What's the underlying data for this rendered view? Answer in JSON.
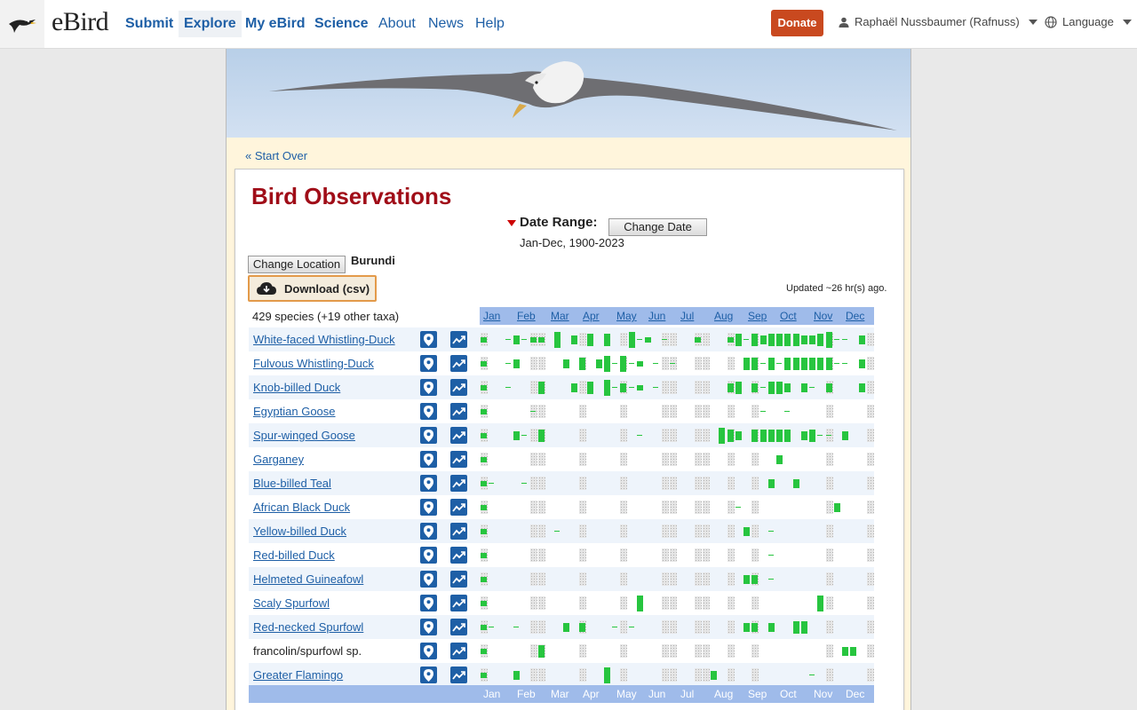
{
  "nav": {
    "logo_word": "eBird",
    "items": [
      {
        "label": "Submit",
        "bold": true
      },
      {
        "label": "Explore",
        "bold": true,
        "active": true
      },
      {
        "label": "My eBird",
        "bold": true
      },
      {
        "label": "Science",
        "bold": true
      },
      {
        "label": "About",
        "bold": false
      },
      {
        "label": "News",
        "bold": false
      },
      {
        "label": "Help",
        "bold": false
      }
    ],
    "donate": "Donate",
    "user": "Raphaël Nussbaumer (Rafnuss)",
    "language": "Language"
  },
  "page": {
    "start_over": "« Start Over",
    "title": "Bird Observations",
    "date_range_label": "Date Range:",
    "change_date": "Change Date",
    "date_range_value": "Jan-Dec, 1900-2023",
    "change_location": "Change Location",
    "location": "Burundi",
    "download": "Download (csv)",
    "updated": "Updated ~26 hr(s) ago.",
    "species_count": "429 species (+19 other taxa)"
  },
  "months": [
    "Jan",
    "Feb",
    "Mar",
    "Apr",
    "May",
    "Jun",
    "Jul",
    "Aug",
    "Sep",
    "Oct",
    "Nov",
    "Dec"
  ],
  "species": [
    {
      "name": "White-faced Whistling-Duck",
      "link": true
    },
    {
      "name": "Fulvous Whistling-Duck",
      "link": true
    },
    {
      "name": "Knob-billed Duck",
      "link": true
    },
    {
      "name": "Egyptian Goose",
      "link": true
    },
    {
      "name": "Spur-winged Goose",
      "link": true
    },
    {
      "name": "Garganey",
      "link": true
    },
    {
      "name": "Blue-billed Teal",
      "link": true
    },
    {
      "name": "African Black Duck",
      "link": true
    },
    {
      "name": "Yellow-billed Duck",
      "link": true
    },
    {
      "name": "Red-billed Duck",
      "link": true
    },
    {
      "name": "Helmeted Guineafowl",
      "link": true
    },
    {
      "name": "Scaly Spurfowl",
      "link": true
    },
    {
      "name": "Red-necked Spurfowl",
      "link": true
    },
    {
      "name": "francolin/spurfowl sp.",
      "link": false
    },
    {
      "name": "Greater Flamingo",
      "link": true
    }
  ],
  "frequency_levels": [
    "0000000000000000000000000000000000000000000000",
    "x0000x0x0x00000000xxxxxxxxxxxxxxxxxxxxxxx00xxx",
    "0x00000000000000x00x00x00x00x00x0x00x0x0x00x00"
  ],
  "bar_rows": [
    [
      "n",
      "n",
      "n",
      "n",
      "n",
      "n",
      "n",
      "n",
      "n",
      "n",
      "n",
      "n",
      "n",
      "n",
      "n",
      "n",
      "n",
      "n",
      "n",
      "n",
      "n",
      "n",
      "n",
      "n",
      "n",
      "n",
      "n",
      "n",
      "n",
      "n",
      "n",
      "n",
      "n",
      "n",
      "n",
      "n",
      "n",
      "n",
      "n",
      "n",
      "n",
      "n",
      "n",
      "n",
      "n",
      "n",
      "n",
      "n"
    ],
    [
      2,
      0,
      0,
      1,
      3,
      1,
      2,
      2,
      0,
      5,
      0,
      3,
      0,
      4,
      0,
      4,
      0,
      0,
      5,
      1,
      2,
      0,
      1,
      0,
      0,
      0,
      2,
      0,
      0,
      0,
      2,
      4,
      1,
      4,
      3,
      4,
      4,
      4,
      4,
      3,
      3,
      4,
      5,
      1,
      1,
      0,
      3,
      0
    ],
    [
      2,
      0,
      0,
      1,
      3,
      0,
      0,
      0,
      0,
      0,
      3,
      0,
      4,
      0,
      3,
      5,
      1,
      5,
      1,
      2,
      0,
      1,
      0,
      1,
      0,
      0,
      0,
      0,
      0,
      0,
      0,
      0,
      4,
      4,
      1,
      4,
      1,
      4,
      4,
      4,
      4,
      4,
      4,
      1,
      1,
      0,
      3,
      0
    ],
    [
      2,
      0,
      0,
      1,
      0,
      0,
      0,
      4,
      0,
      0,
      0,
      3,
      0,
      4,
      0,
      5,
      1,
      3,
      1,
      2,
      0,
      1,
      0,
      0,
      0,
      0,
      0,
      0,
      0,
      0,
      3,
      4,
      0,
      3,
      1,
      4,
      4,
      3,
      0,
      3,
      1,
      0,
      3,
      0,
      0,
      0,
      3,
      0
    ],
    [
      2,
      0,
      0,
      0,
      0,
      0,
      1,
      0,
      0,
      0,
      0,
      0,
      0,
      0,
      0,
      0,
      0,
      0,
      0,
      0,
      0,
      0,
      0,
      0,
      0,
      0,
      0,
      0,
      0,
      0,
      0,
      0,
      0,
      0,
      1,
      0,
      0,
      1,
      0,
      0,
      0,
      0,
      0,
      0,
      0,
      0,
      0,
      0
    ],
    [
      2,
      0,
      0,
      0,
      3,
      1,
      0,
      4,
      0,
      0,
      0,
      0,
      0,
      0,
      0,
      0,
      0,
      0,
      0,
      1,
      0,
      0,
      0,
      0,
      0,
      0,
      0,
      0,
      0,
      5,
      4,
      3,
      0,
      4,
      4,
      4,
      4,
      4,
      0,
      3,
      4,
      1,
      1,
      0,
      3,
      0,
      0,
      0
    ],
    [
      2,
      0,
      0,
      0,
      0,
      0,
      0,
      0,
      0,
      0,
      0,
      0,
      0,
      0,
      0,
      0,
      0,
      0,
      0,
      0,
      0,
      0,
      0,
      0,
      0,
      0,
      0,
      0,
      0,
      0,
      0,
      0,
      0,
      0,
      0,
      0,
      3,
      0,
      0,
      0,
      0,
      0,
      0,
      0,
      0,
      0,
      0,
      0
    ],
    [
      2,
      1,
      0,
      0,
      0,
      1,
      0,
      0,
      0,
      0,
      0,
      0,
      0,
      0,
      0,
      0,
      0,
      0,
      0,
      0,
      0,
      0,
      0,
      0,
      0,
      0,
      0,
      0,
      0,
      0,
      0,
      0,
      0,
      0,
      0,
      3,
      0,
      0,
      3,
      0,
      0,
      0,
      0,
      0,
      0,
      0,
      0,
      0
    ],
    [
      2,
      0,
      0,
      0,
      0,
      0,
      0,
      0,
      0,
      0,
      0,
      0,
      0,
      0,
      0,
      0,
      0,
      0,
      0,
      0,
      0,
      0,
      0,
      0,
      0,
      0,
      0,
      0,
      0,
      0,
      0,
      1,
      0,
      0,
      0,
      0,
      0,
      0,
      0,
      0,
      0,
      0,
      0,
      3,
      0,
      0,
      0,
      0
    ],
    [
      2,
      0,
      0,
      0,
      0,
      0,
      0,
      0,
      0,
      1,
      0,
      0,
      0,
      0,
      0,
      0,
      0,
      0,
      0,
      0,
      0,
      0,
      0,
      0,
      0,
      0,
      0,
      0,
      0,
      0,
      0,
      0,
      3,
      0,
      0,
      1,
      0,
      0,
      0,
      0,
      0,
      0,
      0,
      0,
      0,
      0,
      0,
      0
    ],
    [
      2,
      0,
      0,
      0,
      0,
      0,
      0,
      0,
      0,
      0,
      0,
      0,
      0,
      0,
      0,
      0,
      0,
      0,
      0,
      0,
      0,
      0,
      0,
      0,
      0,
      0,
      0,
      0,
      0,
      0,
      0,
      0,
      0,
      0,
      0,
      1,
      0,
      0,
      0,
      0,
      0,
      0,
      0,
      0,
      0,
      0,
      0,
      0
    ],
    [
      2,
      0,
      0,
      0,
      0,
      0,
      0,
      0,
      0,
      0,
      0,
      0,
      0,
      0,
      0,
      0,
      0,
      0,
      0,
      0,
      0,
      0,
      0,
      0,
      0,
      0,
      0,
      0,
      0,
      0,
      0,
      0,
      3,
      3,
      0,
      1,
      0,
      0,
      0,
      0,
      0,
      0,
      0,
      0,
      0,
      0,
      0,
      0
    ],
    [
      2,
      0,
      0,
      0,
      0,
      0,
      0,
      0,
      0,
      0,
      0,
      0,
      0,
      0,
      0,
      0,
      0,
      0,
      0,
      5,
      0,
      0,
      0,
      0,
      0,
      0,
      0,
      0,
      0,
      0,
      0,
      0,
      0,
      0,
      0,
      0,
      0,
      0,
      0,
      0,
      0,
      5,
      0,
      0,
      0,
      0,
      0,
      0
    ],
    [
      2,
      1,
      0,
      0,
      1,
      0,
      0,
      0,
      0,
      0,
      3,
      0,
      3,
      0,
      0,
      0,
      1,
      0,
      1,
      0,
      0,
      0,
      0,
      0,
      0,
      0,
      0,
      0,
      0,
      0,
      0,
      0,
      3,
      3,
      0,
      3,
      0,
      0,
      4,
      4,
      0,
      0,
      0,
      0,
      0,
      0,
      0,
      0
    ],
    [
      2,
      0,
      0,
      0,
      0,
      0,
      0,
      4,
      0,
      0,
      0,
      0,
      0,
      0,
      0,
      0,
      0,
      0,
      0,
      0,
      0,
      0,
      0,
      0,
      0,
      0,
      0,
      0,
      0,
      0,
      0,
      0,
      0,
      0,
      0,
      0,
      0,
      0,
      0,
      0,
      0,
      0,
      0,
      0,
      3,
      3,
      0,
      0
    ],
    [
      2,
      0,
      0,
      0,
      3,
      0,
      0,
      0,
      0,
      0,
      0,
      0,
      0,
      0,
      0,
      5,
      0,
      0,
      0,
      0,
      0,
      0,
      0,
      0,
      0,
      0,
      0,
      0,
      3,
      0,
      0,
      0,
      0,
      0,
      0,
      0,
      0,
      0,
      0,
      0,
      1,
      0,
      0,
      0,
      0,
      0,
      0,
      0
    ]
  ]
}
